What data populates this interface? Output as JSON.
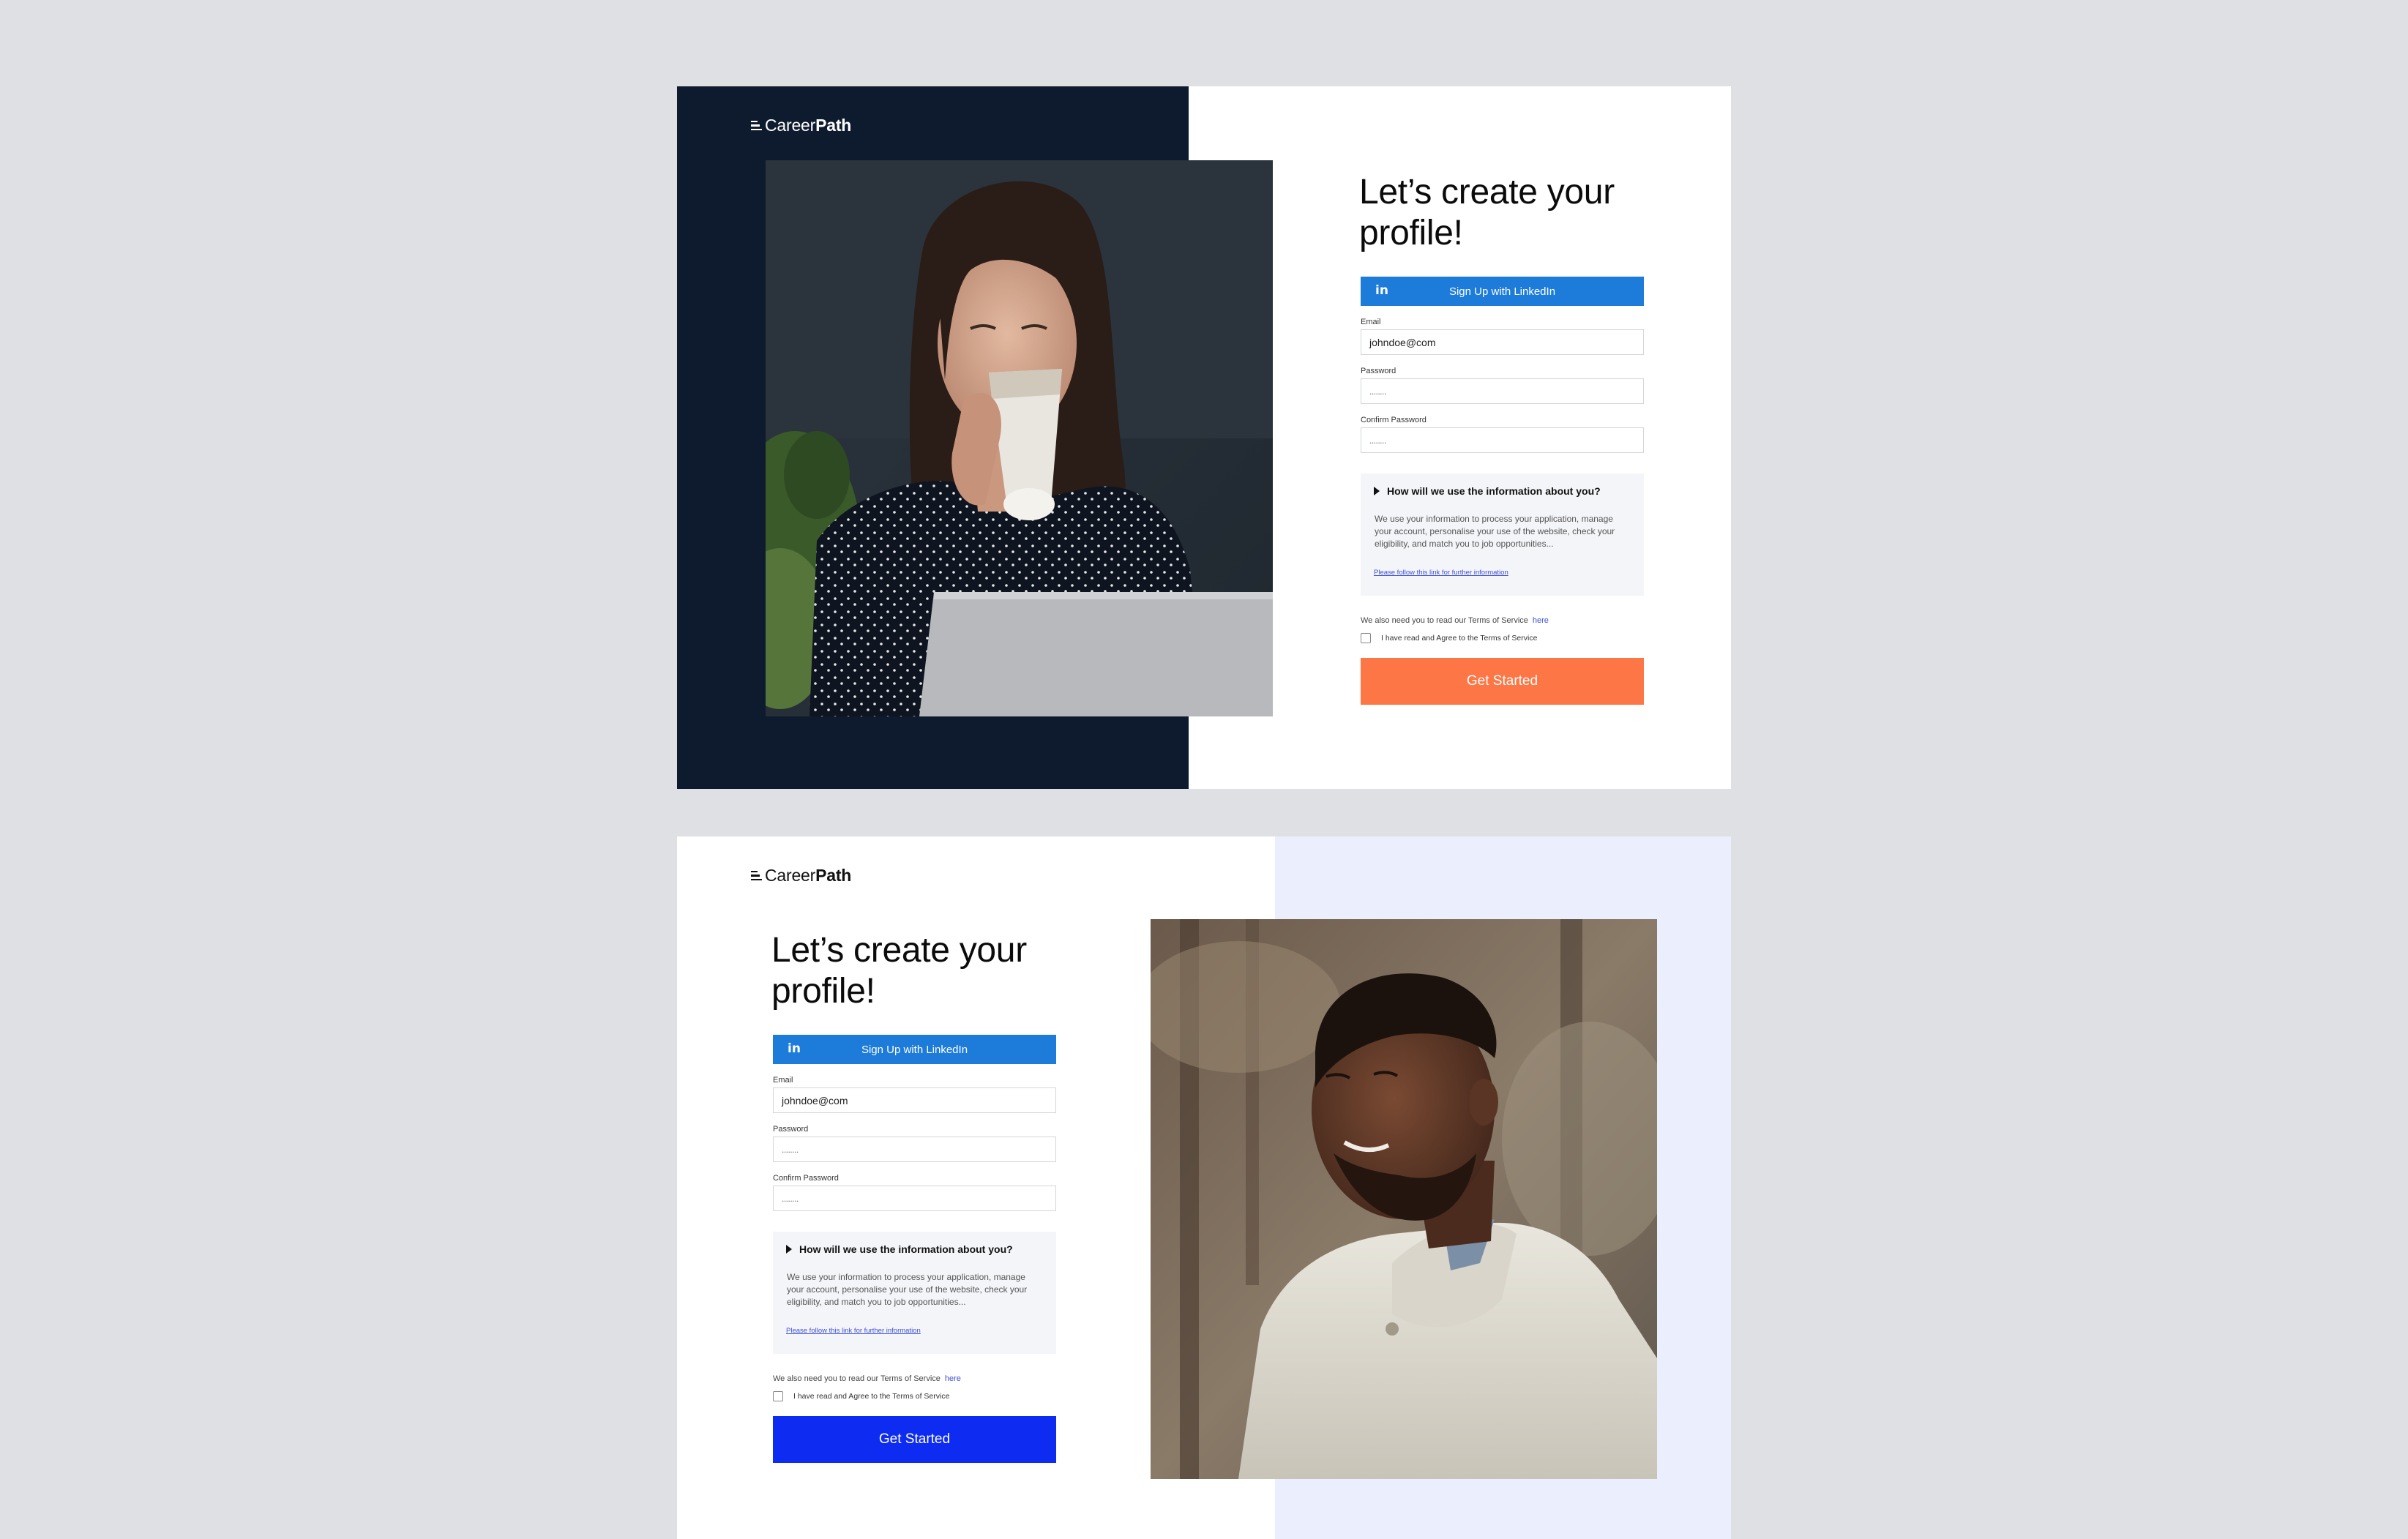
{
  "brand": {
    "name_regular": "Career",
    "name_bold": "Path"
  },
  "colors": {
    "page_bg": "#dfe0e3",
    "dark_panel": "#0e1b2e",
    "light_blue_panel": "#ebeffd",
    "linkedin_blue": "#1d7bd9",
    "cta_orange": "#fc7646",
    "cta_blue": "#0d2bf1",
    "link_color": "#3f51d6"
  },
  "variants": [
    {
      "theme": "dark-left-panel",
      "photo": "woman-drinking-coffee-at-laptop",
      "form": {
        "headline": "Let’s create your profile!",
        "linkedin_icon": "in",
        "linkedin_label": "Sign Up with LinkedIn",
        "email_label": "Email",
        "email_value": "johndoe@com",
        "password_label": "Password",
        "password_value": "........",
        "confirm_label": "Confirm Password",
        "confirm_value": "........",
        "info_title": "How will we use the information about you?",
        "info_body": "We use your information to process your application, manage your account, personalise your use of the website, check your eligibility, and match you to job opportunities...",
        "info_link": "Please follow this link for further information",
        "tos_text": "We also need you to read our Terms of Service",
        "tos_link": "here",
        "agree_label": "I have read and Agree to the Terms of Service",
        "cta_label": "Get Started",
        "cta_color": "#fc7646"
      }
    },
    {
      "theme": "light-blue-right-panel",
      "photo": "smiling-man-in-sweater",
      "form": {
        "headline": "Let’s create your profile!",
        "linkedin_icon": "in",
        "linkedin_label": "Sign Up with LinkedIn",
        "email_label": "Email",
        "email_value": "johndoe@com",
        "password_label": "Password",
        "password_value": "........",
        "confirm_label": "Confirm Password",
        "confirm_value": "........",
        "info_title": "How will we use the information about you?",
        "info_body": "We use your information to process your application, manage your account, personalise your use of the website, check your eligibility, and match you to job opportunities...",
        "info_link": "Please follow this link for further information",
        "tos_text": "We also need you to read our Terms of Service",
        "tos_link": "here",
        "agree_label": "I have read and Agree to the Terms of Service",
        "cta_label": "Get Started",
        "cta_color": "#0d2bf1"
      }
    }
  ]
}
